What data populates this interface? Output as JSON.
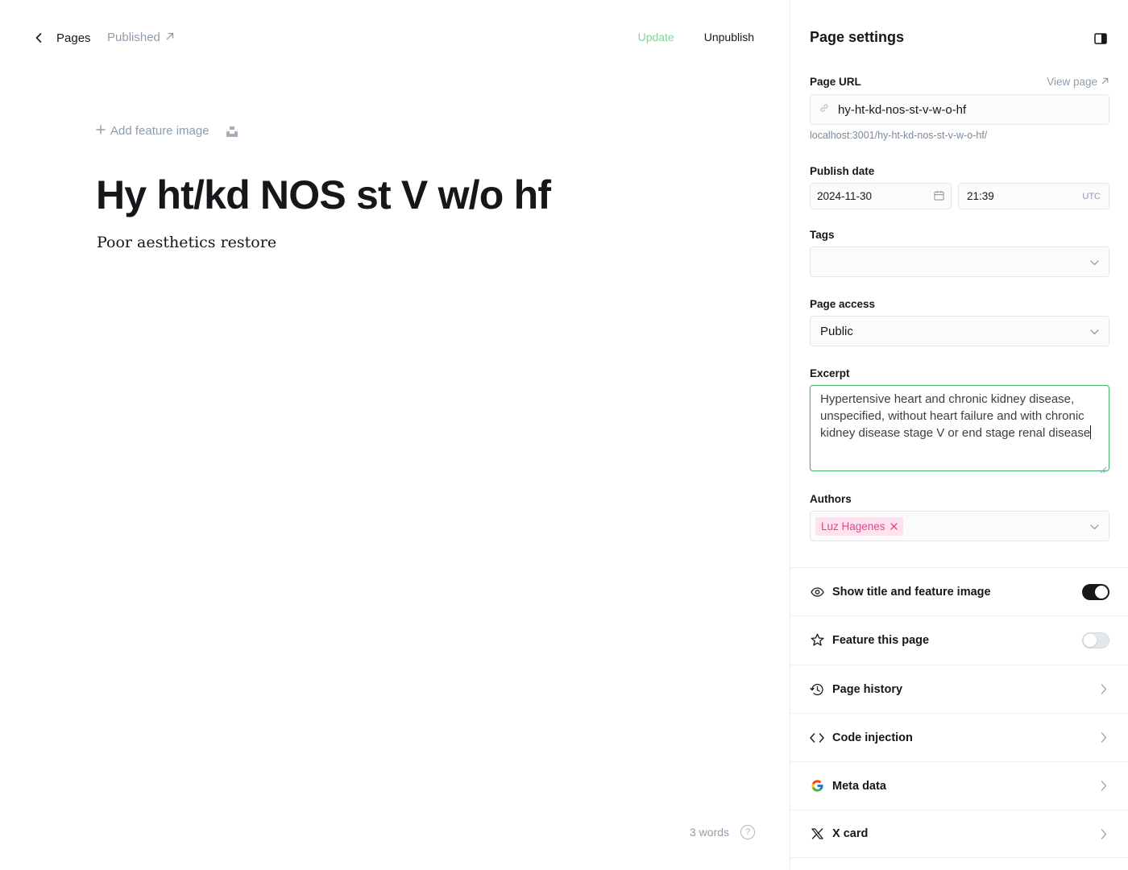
{
  "topbar": {
    "back_label": "Pages",
    "status_label": "Published",
    "update_label": "Update",
    "unpublish_label": "Unpublish"
  },
  "editor": {
    "add_feature_label": "Add feature image",
    "title": "Hy ht/kd NOS st V w/o hf",
    "body": "Poor aesthetics restore",
    "word_count": "3 words",
    "help_glyph": "?"
  },
  "settings": {
    "title": "Page settings",
    "url": {
      "label": "Page URL",
      "view_page": "View page",
      "value": "hy-ht-kd-nos-st-v-w-o-hf",
      "full_url": "localhost:3001/hy-ht-kd-nos-st-v-w-o-hf/"
    },
    "publish_date": {
      "label": "Publish date",
      "date": "2024-11-30",
      "time": "21:39",
      "timezone": "UTC"
    },
    "tags": {
      "label": "Tags",
      "value": ""
    },
    "access": {
      "label": "Page access",
      "value": "Public"
    },
    "excerpt": {
      "label": "Excerpt",
      "value": "Hypertensive heart and chronic kidney disease, unspecified, without heart failure and with chronic kidney disease stage V or end stage renal disease"
    },
    "authors": {
      "label": "Authors",
      "items": [
        "Luz Hagenes"
      ]
    },
    "rows": {
      "show_title": "Show title and feature image",
      "feature": "Feature this page",
      "history": "Page history",
      "code_injection": "Code injection",
      "meta_data": "Meta data",
      "x_card": "X card"
    },
    "toggles": {
      "show_title": true,
      "feature": false
    }
  },
  "colors": {
    "accent_green": "#86d29c",
    "focus_green": "#4fb56c",
    "author_pink": "#e3448e",
    "muted": "#8e9cac"
  }
}
